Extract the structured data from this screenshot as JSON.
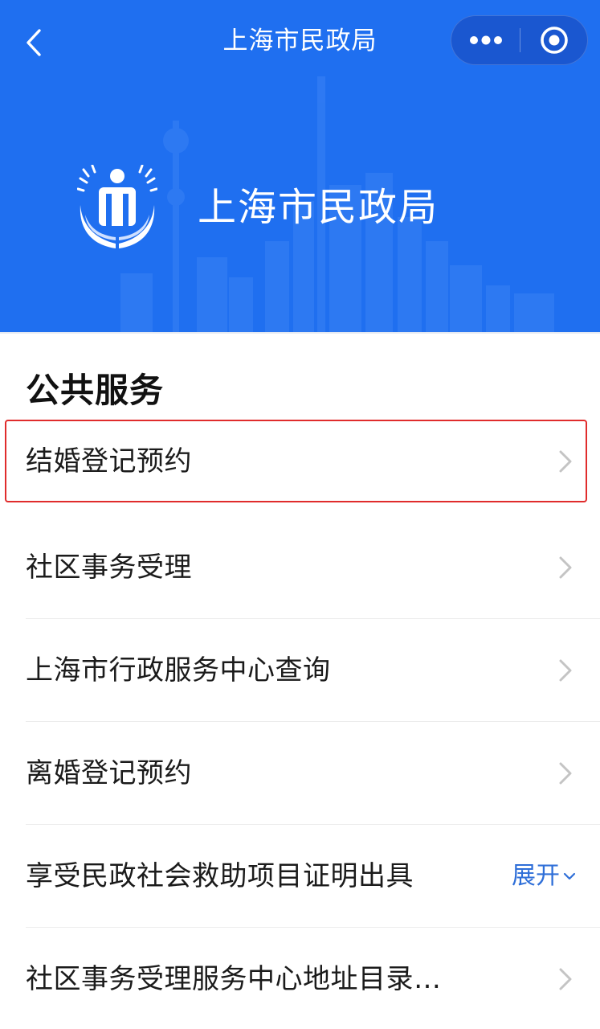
{
  "nav": {
    "title": "上海市民政局"
  },
  "banner": {
    "name": "上海市民政局"
  },
  "services": {
    "section_title": "公共服务",
    "items": [
      {
        "label": "结婚登记预约"
      },
      {
        "label": "社区事务受理"
      },
      {
        "label": "上海市行政服务中心查询"
      },
      {
        "label": "离婚登记预约"
      },
      {
        "label": "享受民政社会救助项目证明出具",
        "action_label": "展开"
      },
      {
        "label": "社区事务受理服务中心地址目录…"
      }
    ]
  },
  "icons": {
    "back": "chevron-left-icon",
    "more": "more-dots-icon",
    "close": "target-circle-icon",
    "logo": "civil-affairs-logo",
    "row_arrow": "chevron-right-icon",
    "expand_arrow": "chevron-down-icon"
  },
  "colors": {
    "banner_blue": "#1f6ff0",
    "highlight_red": "#e02c2c",
    "link_blue": "#2f6fd8"
  }
}
